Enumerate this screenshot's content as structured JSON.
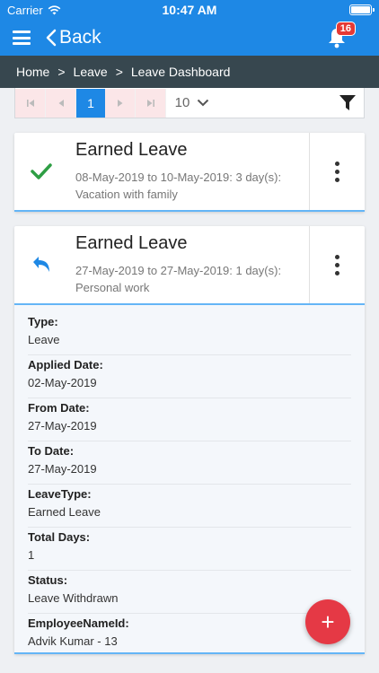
{
  "status_bar": {
    "carrier": "Carrier",
    "time": "10:47 AM"
  },
  "app_bar": {
    "back_label": "Back",
    "notification_count": "16"
  },
  "breadcrumb": {
    "items": [
      "Home",
      "Leave",
      "Leave Dashboard"
    ],
    "separator": ">"
  },
  "pager": {
    "current_page": "1",
    "page_size": "10"
  },
  "cards": [
    {
      "title": "Earned Leave",
      "dates": "08-May-2019 to 10-May-2019: 3 day(s):",
      "reason": "Vacation with family",
      "icon": "check-icon",
      "icon_color": "#2e9e44"
    },
    {
      "title": "Earned Leave",
      "dates": "27-May-2019 to 27-May-2019: 1 day(s):",
      "reason": "Personal work",
      "icon": "undo-icon",
      "icon_color": "#1e88e5",
      "details": [
        {
          "label": "Type:",
          "value": "Leave"
        },
        {
          "label": "Applied Date:",
          "value": "02-May-2019"
        },
        {
          "label": "From Date:",
          "value": "27-May-2019"
        },
        {
          "label": "To Date:",
          "value": "27-May-2019"
        },
        {
          "label": "LeaveType:",
          "value": "Earned Leave"
        },
        {
          "label": "Total Days:",
          "value": "1"
        },
        {
          "label": "Status:",
          "value": "Leave Withdrawn"
        },
        {
          "label": "EmployeeNameId:",
          "value": "Advik Kumar - 13"
        }
      ]
    }
  ],
  "fab": {
    "label": "+"
  },
  "colors": {
    "primary": "#1e88e5",
    "breadcrumb_bg": "#37474f",
    "accent": "#e53945",
    "badge": "#e53935"
  }
}
